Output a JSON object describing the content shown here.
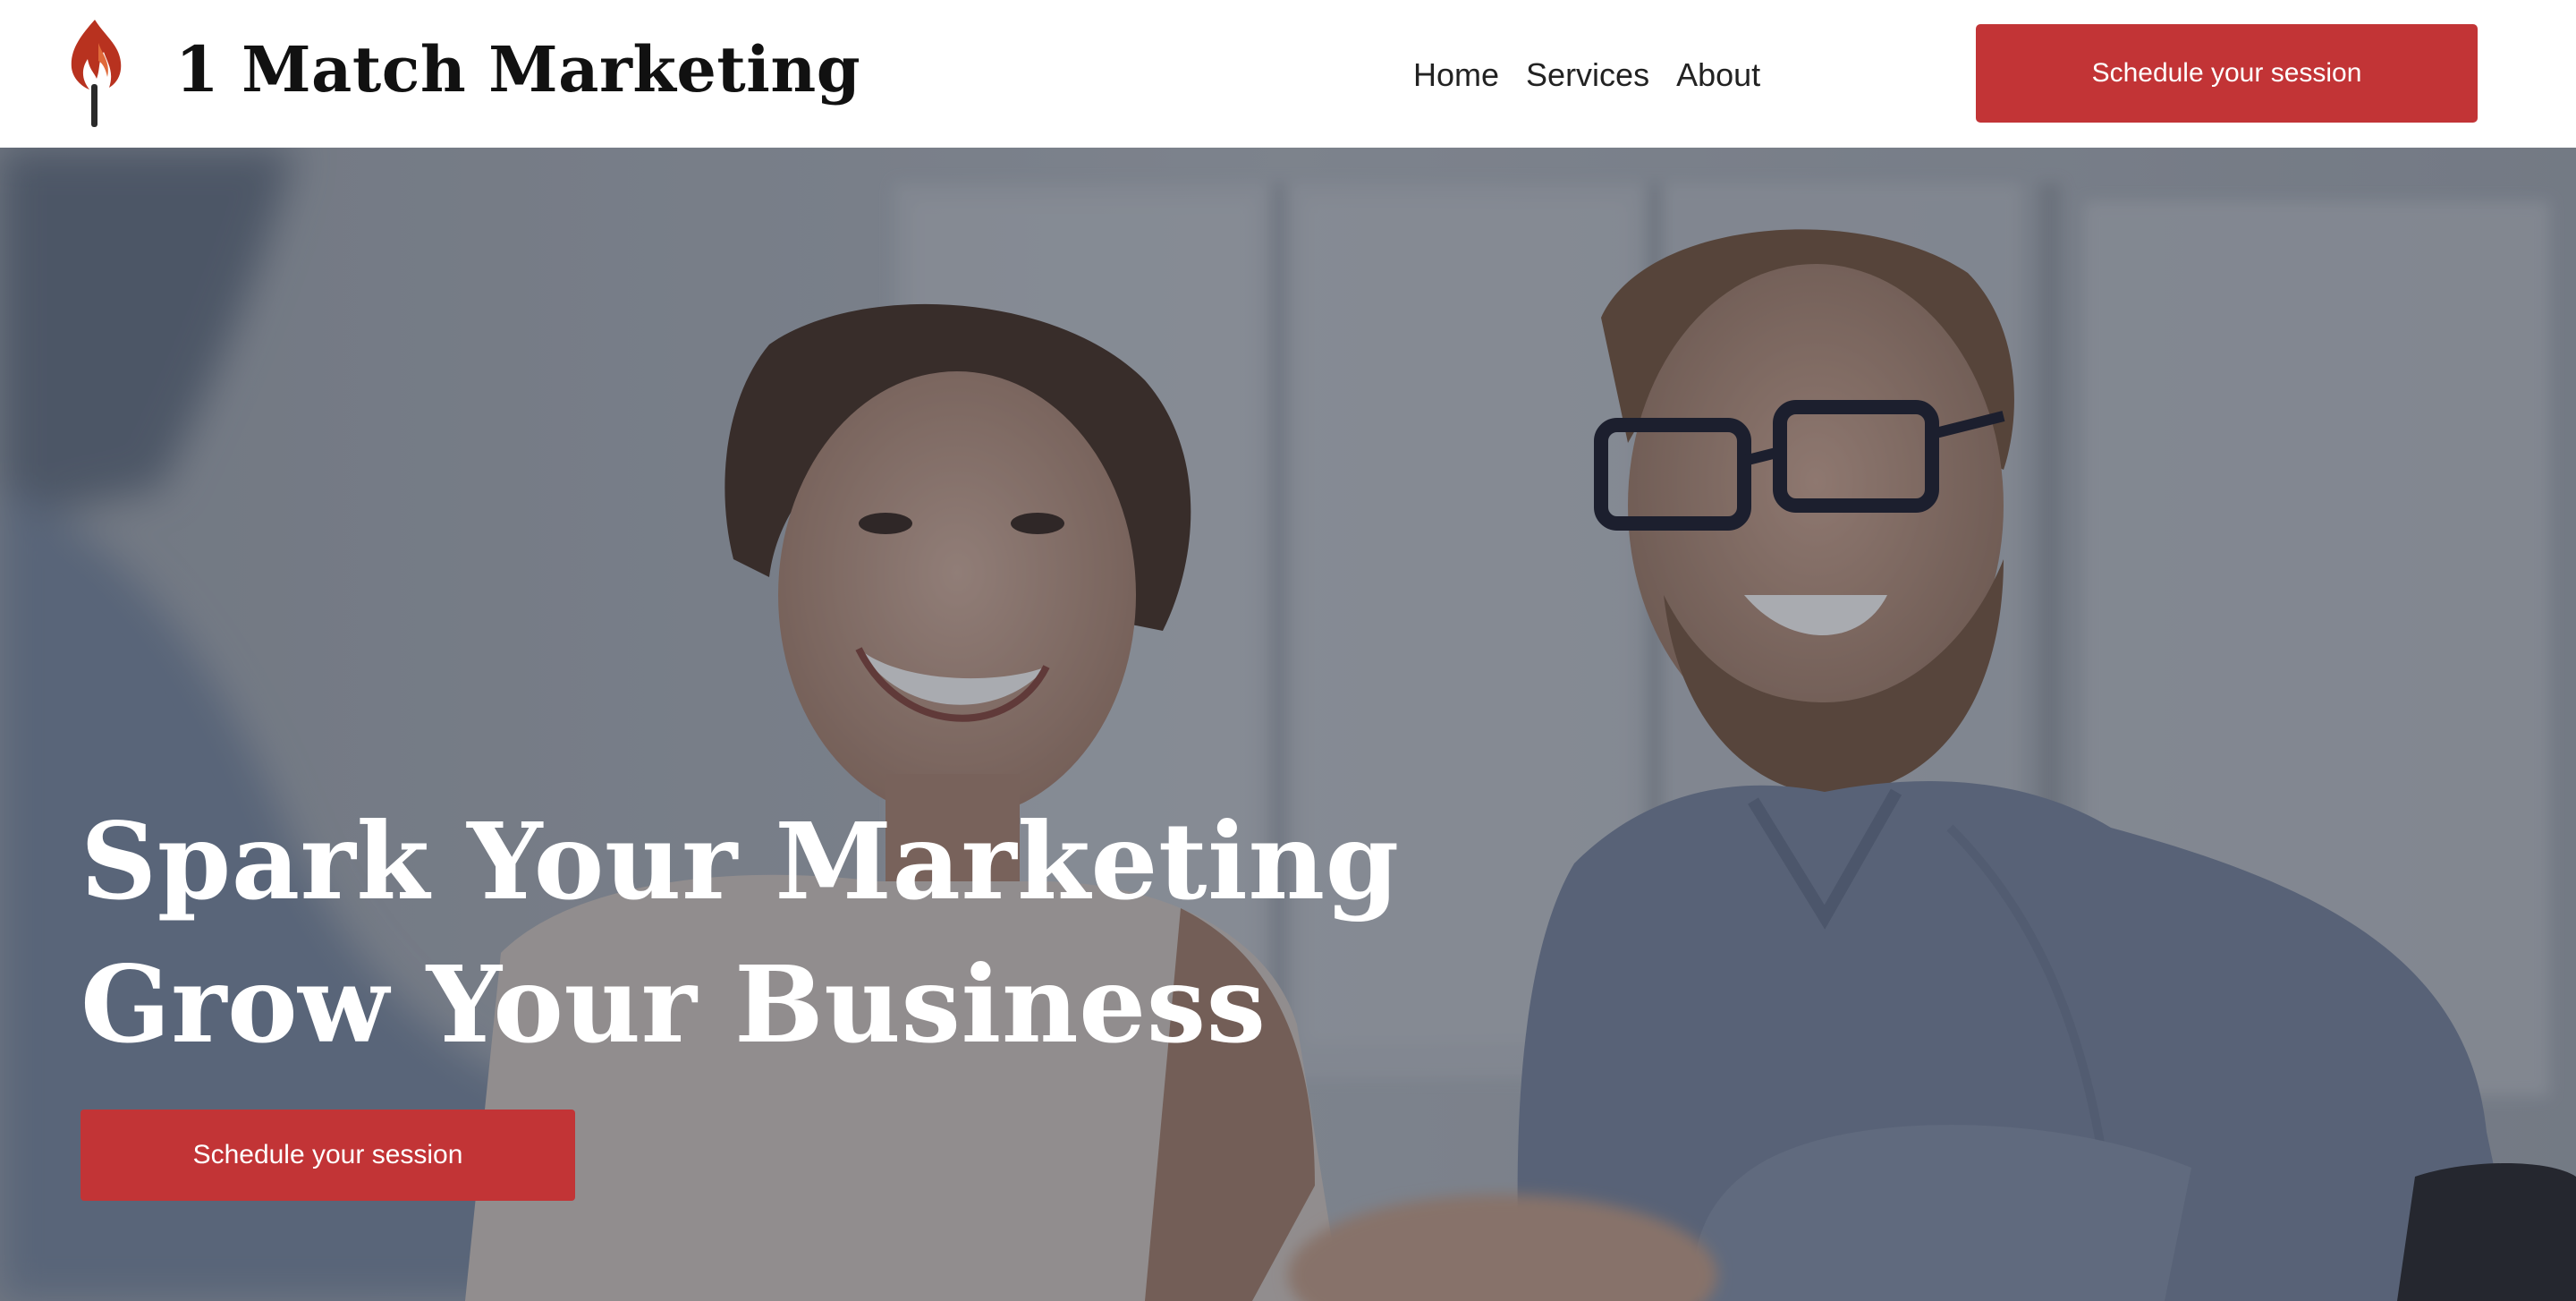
{
  "brand": {
    "name": "1 Match Marketing",
    "logo_icon": "torch-flame-icon",
    "flame_color": "#b8321f",
    "handle_color": "#2a2a2a"
  },
  "nav": {
    "items": [
      {
        "label": "Home"
      },
      {
        "label": "Services"
      },
      {
        "label": "About"
      }
    ]
  },
  "header": {
    "cta_label": "Schedule your session"
  },
  "hero": {
    "title_line1": "Spark Your Marketing",
    "title_line2": "Grow Your Business",
    "cta_label": "Schedule your session",
    "photo_subject": "two smiling colleagues at a business meeting shaking hands"
  },
  "colors": {
    "accent": "#c23436",
    "text_dark": "#111111",
    "nav_text": "#222222",
    "hero_text": "#ffffff"
  }
}
